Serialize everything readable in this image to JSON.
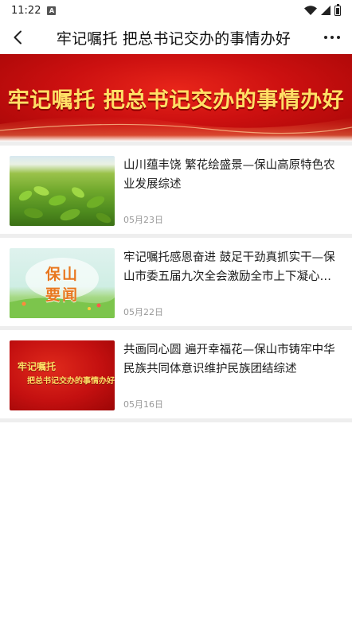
{
  "status_bar": {
    "time": "11:22",
    "notification_icon": "A"
  },
  "nav": {
    "title": "牢记嘱托  把总书记交办的事情办好",
    "back_icon": "chevron-left-icon",
    "more_icon": "more-dots-icon"
  },
  "banner": {
    "title": "牢记嘱托 把总书记交办的事情办好"
  },
  "articles": [
    {
      "title": "山川蕴丰饶  繁花绘盛景—保山高原特色农业发展综述",
      "date": "05月23日"
    },
    {
      "title": "牢记嘱托感恩奋进    鼓足干劲真抓实干—保山市委五届九次全会激励全市上下凝心聚力",
      "date": "05月22日",
      "thumb_text": "保山\n要闻"
    },
    {
      "title": "共画同心圆    遍开幸福花—保山市铸牢中华民族共同体意识维护民族团结综述",
      "date": "05月16日",
      "thumb_text_line1": "牢记嘱托",
      "thumb_text_line2": "把总书记交办的事情办好"
    }
  ],
  "colors": {
    "banner_red": "#cc1010",
    "banner_text": "#ffe066",
    "date_gray": "#999999",
    "divider": "#eeeeee"
  }
}
